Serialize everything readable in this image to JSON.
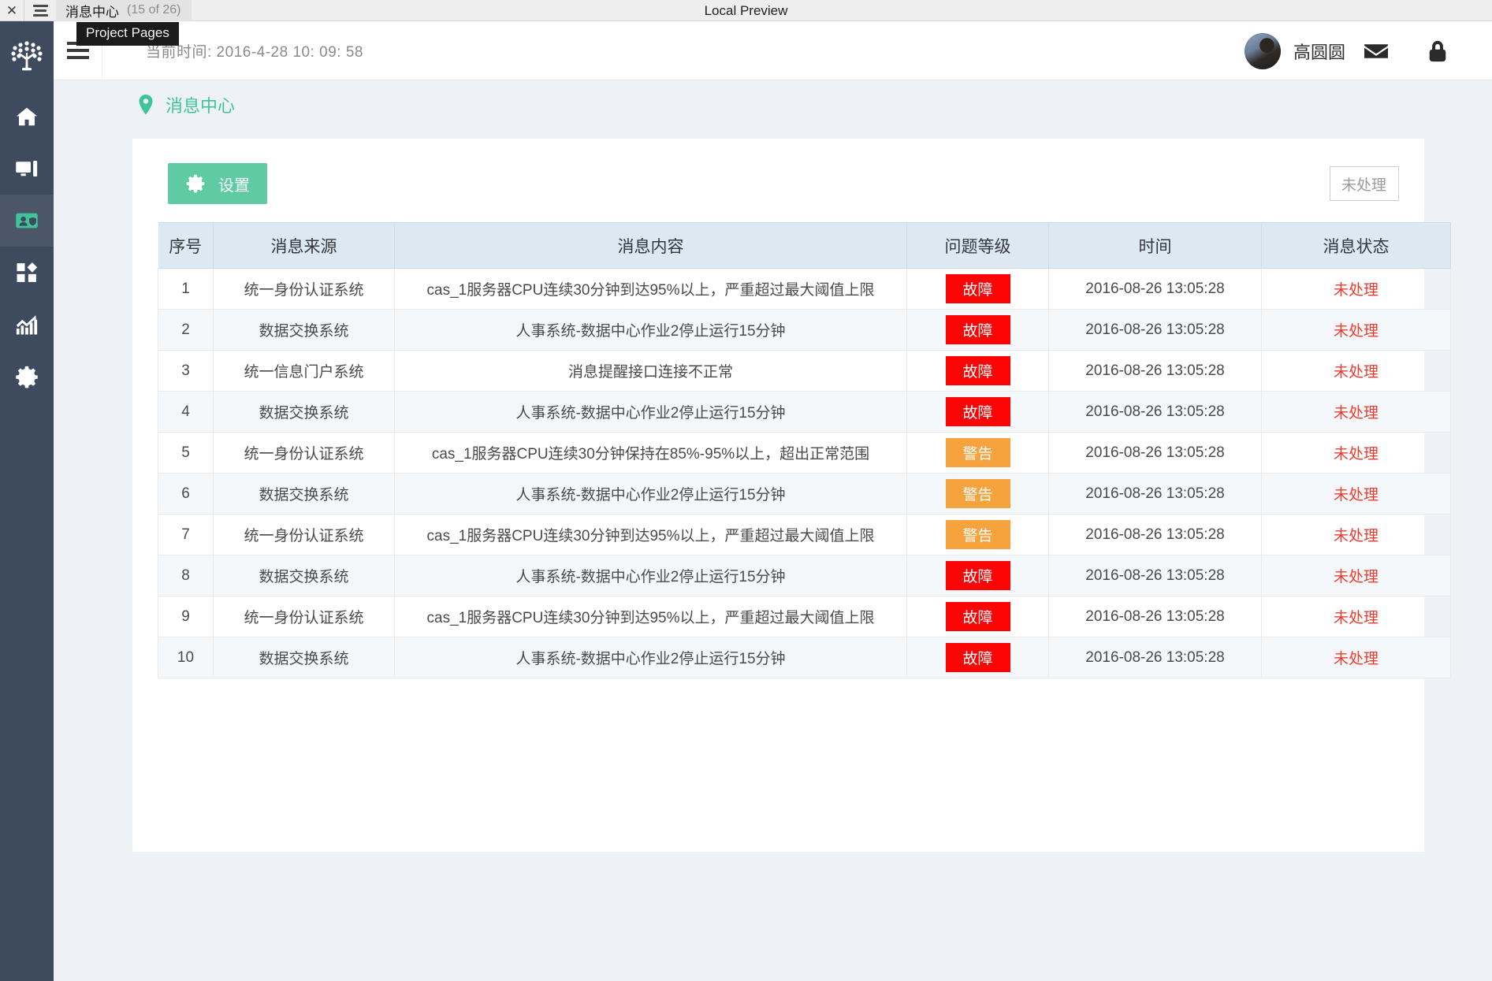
{
  "chrome": {
    "close_label": "✕",
    "hamburger_icon": "hamburger-icon",
    "tab_title": "消息中心",
    "tab_count": "(15 of 26)",
    "center_title": "Local Preview",
    "tooltip": "Project Pages"
  },
  "sidebar": {
    "logo_name": "tree-logo",
    "items": [
      {
        "name": "home",
        "icon": "home-icon",
        "active": false
      },
      {
        "name": "monitor",
        "icon": "monitor-icon",
        "active": false
      },
      {
        "name": "identity",
        "icon": "id-card-icon",
        "active": true
      },
      {
        "name": "modules",
        "icon": "grid-shapes-icon",
        "active": false
      },
      {
        "name": "analytics",
        "icon": "chart-growth-icon",
        "active": false
      },
      {
        "name": "settings",
        "icon": "gear-icon",
        "active": false
      }
    ]
  },
  "header": {
    "menu_icon": "hamburger-icon",
    "clock": "当前时间: 2016-4-28   10: 09: 58",
    "user_name": "高圆圆",
    "avatar_name": "user-avatar",
    "mail_icon": "envelope-icon",
    "lock_icon": "lock-icon"
  },
  "page": {
    "pin_icon": "location-pin-icon",
    "title": "消息中心"
  },
  "toolbar": {
    "gear_icon": "gear-icon",
    "setting_label": "设置",
    "filter_value": "未处理",
    "filter_placeholder": "未处理"
  },
  "colors": {
    "accent_green": "#3fc49a",
    "button_green": "#5ecba5",
    "fault_red": "#fb0404",
    "warn_orange": "#f6a23d",
    "status_red": "#ee3b2f",
    "sidebar_dark": "#3e4b5e",
    "table_head": "#dce8f2"
  },
  "table": {
    "columns": [
      "序号",
      "消息来源",
      "消息内容",
      "问题等级",
      "时间",
      "消息状态"
    ],
    "rows": [
      {
        "idx": "1",
        "source": "统一身份认证系统",
        "content": "cas_1服务器CPU连续30分钟到达95%以上，严重超过最大阈值上限",
        "level": "故障",
        "level_type": "fault",
        "time": "2016-08-26  13:05:28",
        "status": "未处理"
      },
      {
        "idx": "2",
        "source": "数据交换系统",
        "content": "人事系统-数据中心作业2停止运行15分钟",
        "level": "故障",
        "level_type": "fault",
        "time": "2016-08-26  13:05:28",
        "status": "未处理"
      },
      {
        "idx": "3",
        "source": "统一信息门户系统",
        "content": "消息提醒接口连接不正常",
        "level": "故障",
        "level_type": "fault",
        "time": "2016-08-26  13:05:28",
        "status": "未处理"
      },
      {
        "idx": "4",
        "source": "数据交换系统",
        "content": "人事系统-数据中心作业2停止运行15分钟",
        "level": "故障",
        "level_type": "fault",
        "time": "2016-08-26  13:05:28",
        "status": "未处理"
      },
      {
        "idx": "5",
        "source": "统一身份认证系统",
        "content": "cas_1服务器CPU连续30分钟保持在85%-95%以上，超出正常范围",
        "level": "警告",
        "level_type": "warn",
        "time": "2016-08-26  13:05:28",
        "status": "未处理"
      },
      {
        "idx": "6",
        "source": "数据交换系统",
        "content": "人事系统-数据中心作业2停止运行15分钟",
        "level": "警告",
        "level_type": "warn",
        "time": "2016-08-26  13:05:28",
        "status": "未处理"
      },
      {
        "idx": "7",
        "source": "统一身份认证系统",
        "content": "cas_1服务器CPU连续30分钟到达95%以上，严重超过最大阈值上限",
        "level": "警告",
        "level_type": "warn",
        "time": "2016-08-26  13:05:28",
        "status": "未处理"
      },
      {
        "idx": "8",
        "source": "数据交换系统",
        "content": "人事系统-数据中心作业2停止运行15分钟",
        "level": "故障",
        "level_type": "fault",
        "time": "2016-08-26  13:05:28",
        "status": "未处理"
      },
      {
        "idx": "9",
        "source": "统一身份认证系统",
        "content": "cas_1服务器CPU连续30分钟到达95%以上，严重超过最大阈值上限",
        "level": "故障",
        "level_type": "fault",
        "time": "2016-08-26  13:05:28",
        "status": "未处理"
      },
      {
        "idx": "10",
        "source": "数据交换系统",
        "content": "人事系统-数据中心作业2停止运行15分钟",
        "level": "故障",
        "level_type": "fault",
        "time": "2016-08-26  13:05:28",
        "status": "未处理"
      }
    ]
  }
}
